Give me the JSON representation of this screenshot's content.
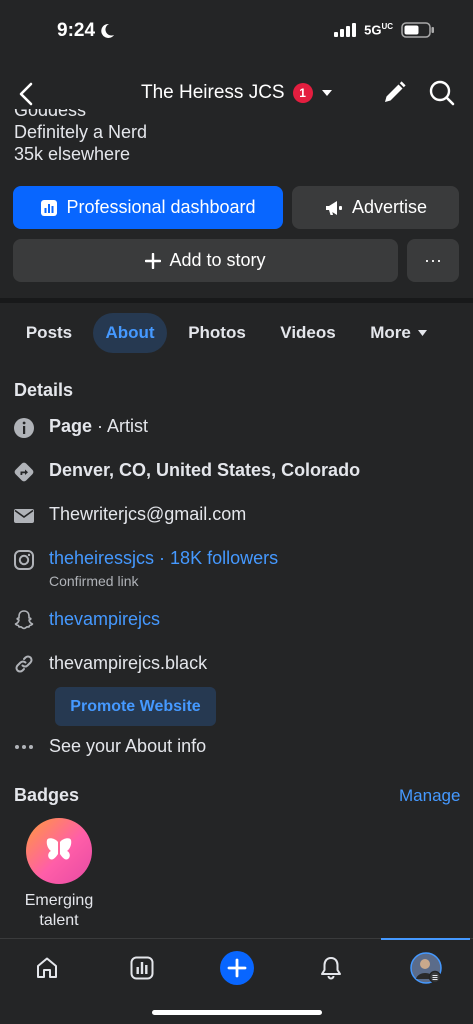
{
  "status_bar": {
    "time": "9:24",
    "network": "5G",
    "network_suffix": "UC"
  },
  "header": {
    "title": "The Heiress JCS",
    "notification_count": "1"
  },
  "bio": {
    "clipped_line": "Goddess",
    "line1": "Definitely a Nerd",
    "line2": "35k elsewhere"
  },
  "buttons": {
    "dashboard": "Professional dashboard",
    "advertise": "Advertise",
    "add_story": "Add to story",
    "more": "···"
  },
  "tabs": {
    "posts": "Posts",
    "about": "About",
    "photos": "Photos",
    "videos": "Videos",
    "more": "More"
  },
  "details": {
    "title": "Details",
    "category_label": "Page",
    "category_sep": " · ",
    "category_value": "Artist",
    "location": "Denver, CO, United States, Colorado",
    "email": "Thewriterjcs@gmail.com",
    "instagram": "theheiressjcs · 18K followers",
    "instagram_sub": "Confirmed link",
    "snapchat": "thevampirejcs",
    "website": "thevampirejcs.black",
    "promote_website": "Promote Website",
    "see_about": "See your About info"
  },
  "badges": {
    "title": "Badges",
    "manage": "Manage",
    "item_label_line1": "Emerging",
    "item_label_line2": "talent"
  },
  "colors": {
    "accent": "#0866ff",
    "link": "#4599ff",
    "background": "#242526",
    "button": "#3a3b3c",
    "badge_red": "#e41e3f"
  }
}
